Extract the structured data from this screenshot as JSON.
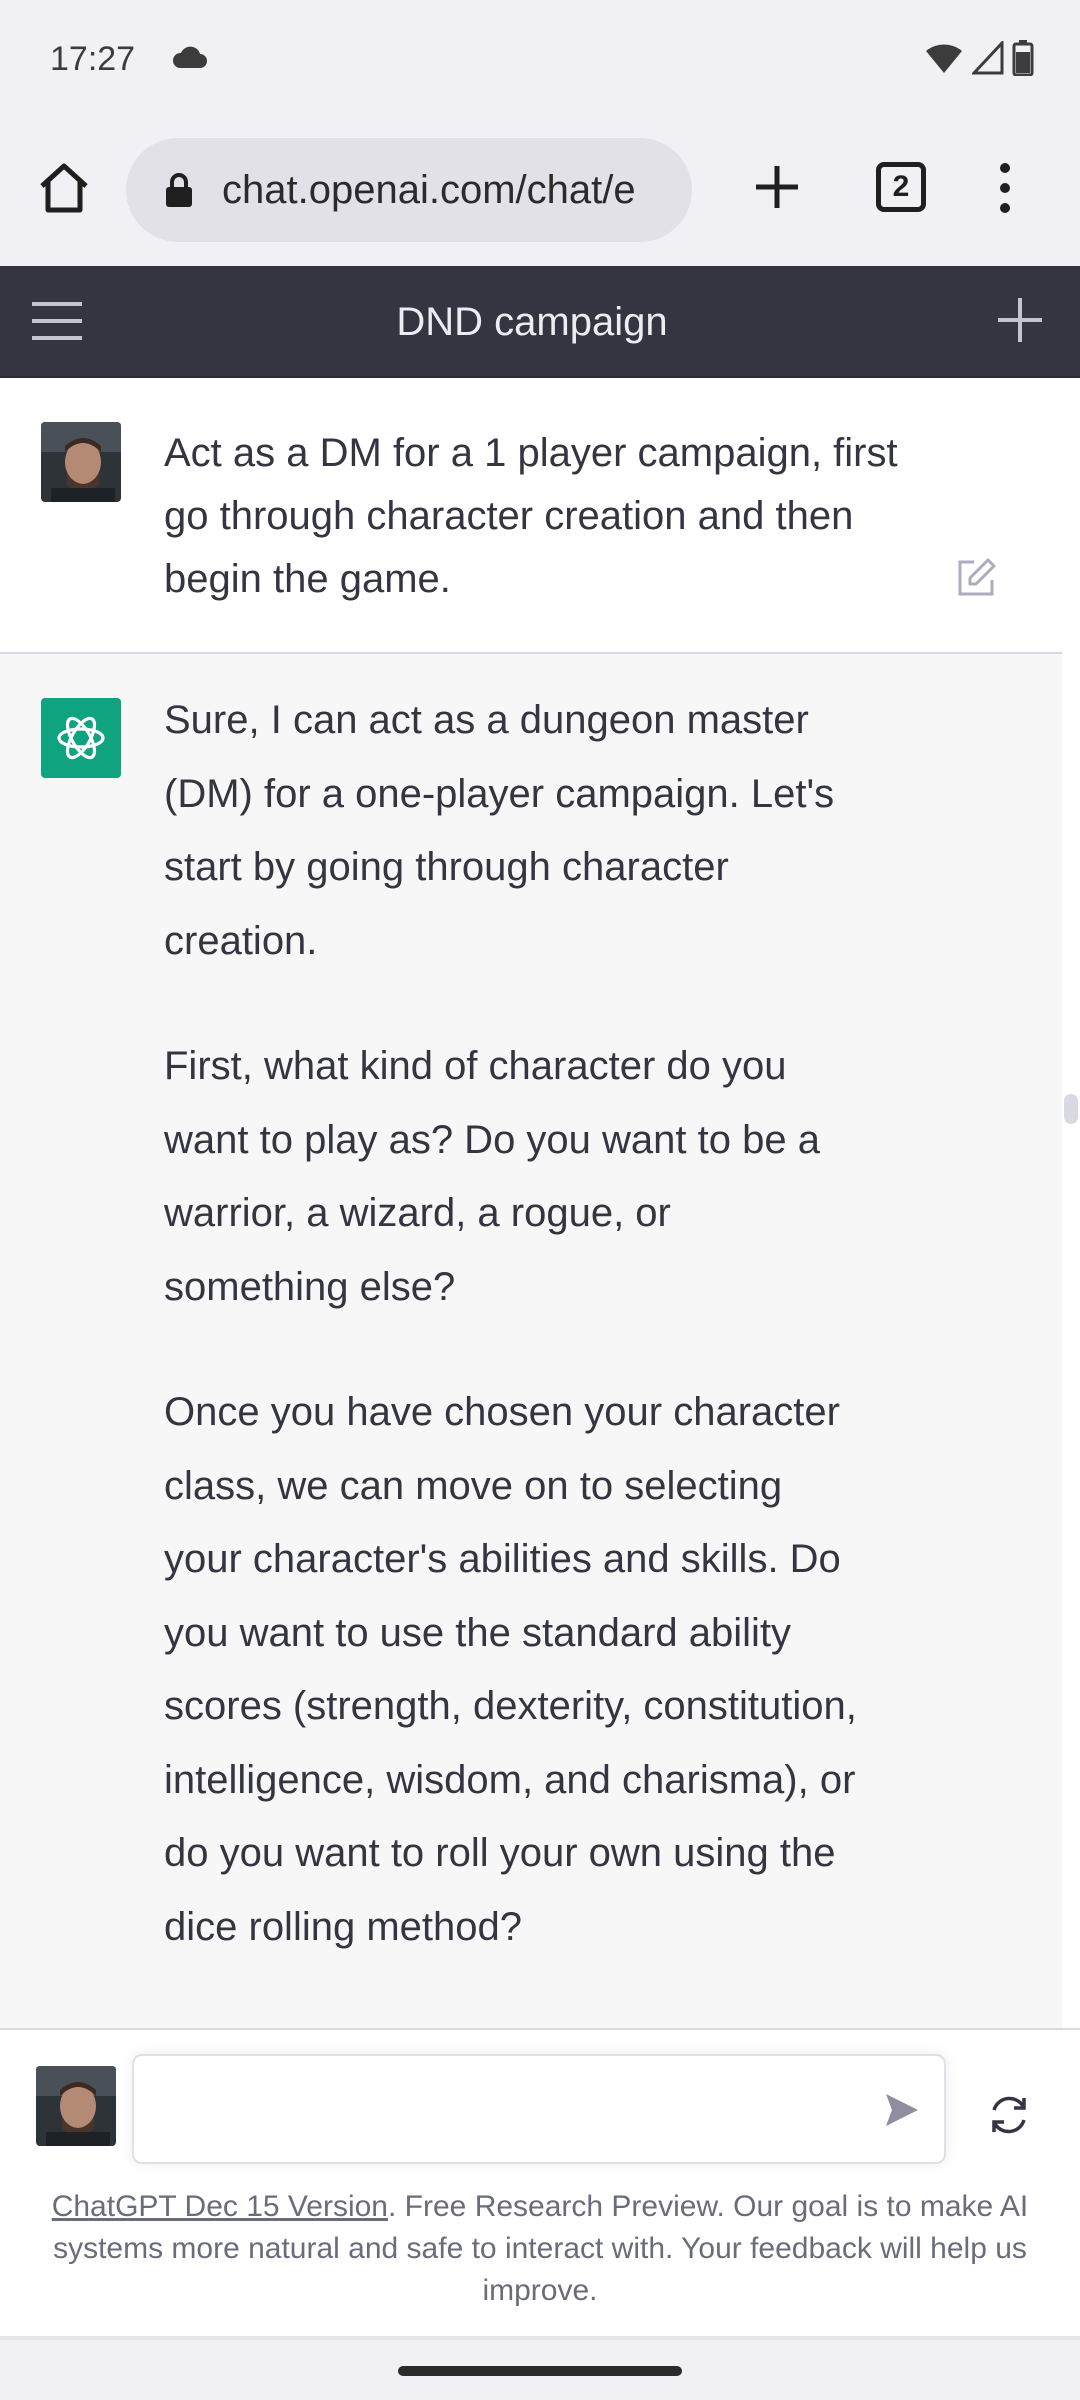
{
  "status_bar": {
    "time": "17:27"
  },
  "browser": {
    "url": "chat.openai.com/chat/e",
    "tab_count": "2"
  },
  "app": {
    "title": "DND campaign"
  },
  "conversation": {
    "user_message": "Act as a DM for a 1 player campaign, first go through character creation and then begin the game.",
    "assistant_paragraphs": [
      "Sure, I can act as a dungeon master (DM) for a one-player campaign. Let's start by going through character creation.",
      "First, what kind of character do you want to play as? Do you want to be a warrior, a wizard, a rogue, or something else?",
      "Once you have chosen your character class, we can move on to selecting your character's abilities and skills. Do you want to use the standard ability scores (strength, dexterity, constitution, intelligence, wisdom, and charisma), or do you want to roll your own using the dice rolling method?"
    ]
  },
  "composer": {
    "input_value": "",
    "disclaimer_link": "ChatGPT Dec 15 Version",
    "disclaimer_text": ". Free Research Preview. Our goal is to make AI systems more natural and safe to interact with. Your feedback will help us improve."
  },
  "colors": {
    "header_bg": "#343541",
    "assistant_bg": "#f7f7f8",
    "bot_avatar_bg": "#10a37f"
  }
}
